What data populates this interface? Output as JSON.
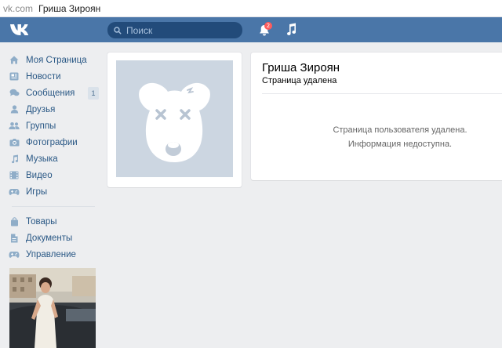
{
  "browser": {
    "domain": "vk.com",
    "page_title": "Гриша Зироян"
  },
  "header": {
    "search_placeholder": "Поиск",
    "notifications_count": "2",
    "brand_color": "#4a76a8"
  },
  "sidebar": {
    "items": [
      {
        "label": "Моя Страница",
        "icon": "home-icon"
      },
      {
        "label": "Новости",
        "icon": "news-icon"
      },
      {
        "label": "Сообщения",
        "icon": "messages-icon",
        "count": "1"
      },
      {
        "label": "Друзья",
        "icon": "friend-icon"
      },
      {
        "label": "Группы",
        "icon": "groups-icon"
      },
      {
        "label": "Фотографии",
        "icon": "camera-icon"
      },
      {
        "label": "Музыка",
        "icon": "music-note-icon"
      },
      {
        "label": "Видео",
        "icon": "video-icon"
      },
      {
        "label": "Игры",
        "icon": "gamepad-icon"
      }
    ],
    "items2": [
      {
        "label": "Товары",
        "icon": "bag-icon"
      },
      {
        "label": "Документы",
        "icon": "document-icon"
      },
      {
        "label": "Управление",
        "icon": "gamepad-icon"
      }
    ]
  },
  "profile": {
    "name": "Гриша Зироян",
    "status": "Страница удалена",
    "message_line1": "Страница пользователя удалена.",
    "message_line2": "Информация недоступна."
  }
}
